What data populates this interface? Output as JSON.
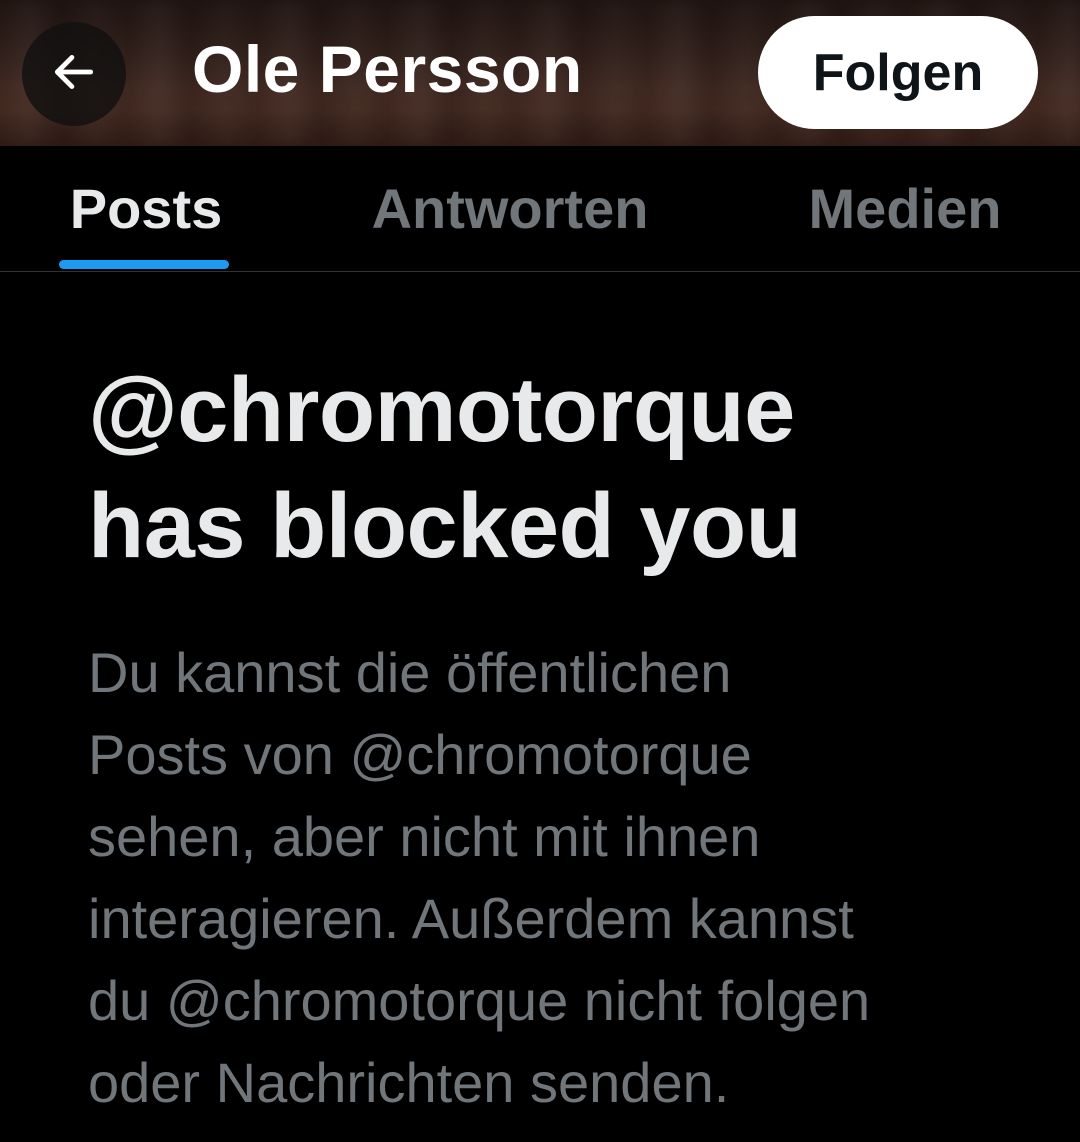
{
  "header": {
    "back_icon": "arrow-left-icon",
    "profile_name": "Ole Persson",
    "follow_label": "Folgen"
  },
  "tabs": [
    {
      "label": "Posts",
      "active": true
    },
    {
      "label": "Antworten",
      "active": false
    },
    {
      "label": "Medien",
      "active": false
    }
  ],
  "message": {
    "title_line1": "@chromotorque",
    "title_line2": "has blocked you",
    "desc_lines": [
      "Du kannst die öffentlichen",
      "Posts von @chromotorque",
      "sehen, aber nicht mit ihnen",
      "interagieren. Außerdem kannst",
      "du @chromotorque nicht folgen",
      "oder Nachrichten senden."
    ]
  },
  "colors": {
    "background": "#000000",
    "primary_text": "#e7e9ea",
    "secondary_text": "#71767b",
    "accent": "#1d9bf0",
    "divider": "#2f3336"
  }
}
